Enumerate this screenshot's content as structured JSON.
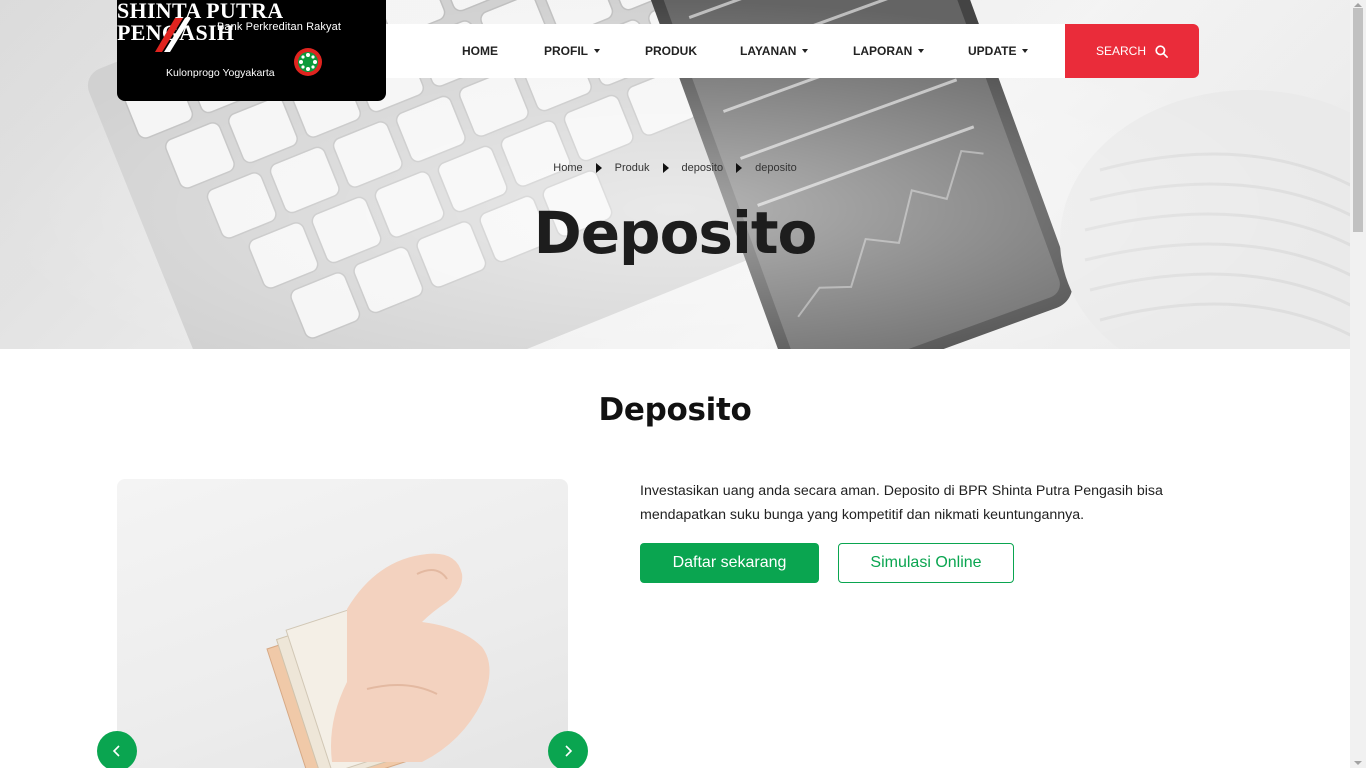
{
  "brand": {
    "line_top": "Bank Perkreditan Rakyat",
    "line_name_1": "SHINTA PUTRA",
    "line_name_2": "PENGASIH",
    "line_bottom": "Kulonprogo Yogyakarta"
  },
  "nav": {
    "items": [
      {
        "label": "HOME",
        "dropdown": false
      },
      {
        "label": "PROFIL",
        "dropdown": true
      },
      {
        "label": "PRODUK",
        "dropdown": false
      },
      {
        "label": "LAYANAN",
        "dropdown": true
      },
      {
        "label": "LAPORAN",
        "dropdown": true
      },
      {
        "label": "UPDATE",
        "dropdown": true
      }
    ],
    "search_label": "SEARCH"
  },
  "breadcrumb": [
    "Home",
    "Produk",
    "deposito",
    "deposito"
  ],
  "hero": {
    "title": "Deposito"
  },
  "content": {
    "section_title": "Deposito",
    "description": "Investasikan uang anda secara aman. Deposito di BPR Shinta Putra Pengasih bisa mendapatkan suku bunga yang kompetitif dan nikmati keuntungannya.",
    "primary_button": "Daftar sekarang",
    "secondary_button": "Simulasi Online"
  },
  "icons": {
    "search": "search-icon",
    "carousel_prev": "chevron-left-icon",
    "carousel_next": "chevron-right-icon"
  },
  "colors": {
    "brand_green": "#0aa550",
    "search_red": "#ea2c3a",
    "logo_bg": "#000000"
  }
}
